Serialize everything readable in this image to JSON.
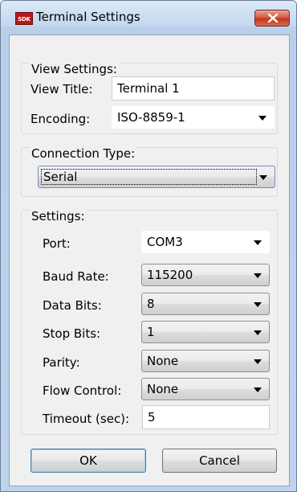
{
  "window": {
    "title": "Terminal Settings",
    "app_icon_text": "SDK"
  },
  "view_settings": {
    "group_title": "View Settings:",
    "view_title_label": "View Title:",
    "view_title_value": "Terminal 1",
    "encoding_label": "Encoding:",
    "encoding_value": "ISO-8859-1"
  },
  "connection": {
    "group_title": "Connection Type:",
    "type_value": "Serial"
  },
  "settings": {
    "group_title": "Settings:",
    "port_label": "Port:",
    "port_value": "COM3",
    "baud_label": "Baud Rate:",
    "baud_value": "115200",
    "data_bits_label": "Data Bits:",
    "data_bits_value": "8",
    "stop_bits_label": "Stop Bits:",
    "stop_bits_value": "1",
    "parity_label": "Parity:",
    "parity_value": "None",
    "flow_label": "Flow Control:",
    "flow_value": "None",
    "timeout_label": "Timeout (sec):",
    "timeout_value": "5"
  },
  "buttons": {
    "ok": "OK",
    "cancel": "Cancel"
  },
  "colors": {
    "close_button": "#c0391f",
    "default_button_border": "#3c7fb1"
  }
}
